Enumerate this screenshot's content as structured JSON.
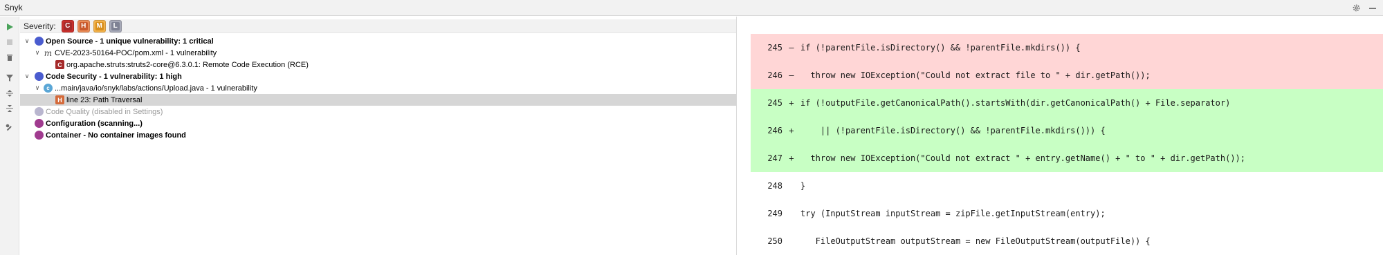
{
  "window": {
    "title": "Snyk"
  },
  "severity": {
    "label": "Severity:",
    "buttons": [
      {
        "letter": "C",
        "outer": "#c9302c",
        "inner": "#a52a2a"
      },
      {
        "letter": "H",
        "outer": "#e98c58",
        "inner": "#c95a2c"
      },
      {
        "letter": "M",
        "outer": "#f2b24b",
        "inner": "#d88f1c"
      },
      {
        "letter": "L",
        "outer": "#a7aab8",
        "inner": "#7e8294"
      }
    ]
  },
  "tree": {
    "open_source": "Open Source - 1 unique vulnerability: 1 critical",
    "pom_file": "CVE-2023-50164-POC/pom.xml - 1 vulnerability",
    "pom_icon": "m",
    "struts_issue": "org.apache.struts:struts2-core@6.3.0.1: Remote Code Execution (RCE)",
    "struts_sev": "C",
    "code_security": "Code Security - 1 vulnerability: 1 high",
    "upload_file": "...main/java/io/snyk/labs/actions/Upload.java - 1 vulnerability",
    "upload_icon": "c",
    "path_traversal": "line 23: Path Traversal",
    "path_sev": "H",
    "code_quality": "Code Quality (disabled in Settings)",
    "configuration": "Configuration (scanning...)",
    "container": "Container - No container images found"
  },
  "diff": {
    "lines": [
      {
        "num": "245",
        "sign": "–",
        "type": "del",
        "code": "if (!parentFile.isDirectory() && !parentFile.mkdirs()) {"
      },
      {
        "num": "246",
        "sign": "–",
        "type": "del",
        "code": "  throw new IOException(\"Could not extract file to \" + dir.getPath());"
      },
      {
        "num": "245",
        "sign": "+",
        "type": "add",
        "code": "if (!outputFile.getCanonicalPath().startsWith(dir.getCanonicalPath() + File.separator)"
      },
      {
        "num": "246",
        "sign": "+",
        "type": "add",
        "code": "    || (!parentFile.isDirectory() && !parentFile.mkdirs())) {"
      },
      {
        "num": "247",
        "sign": "+",
        "type": "add",
        "code": "  throw new IOException(\"Could not extract \" + entry.getName() + \" to \" + dir.getPath());"
      },
      {
        "num": "248",
        "sign": "",
        "type": "ctx",
        "code": "}"
      },
      {
        "num": "249",
        "sign": "",
        "type": "ctx",
        "code": "try (InputStream inputStream = zipFile.getInputStream(entry);"
      },
      {
        "num": "250",
        "sign": "",
        "type": "ctx",
        "code": "   FileOutputStream outputStream = new FileOutputStream(outputFile)) {"
      }
    ]
  }
}
